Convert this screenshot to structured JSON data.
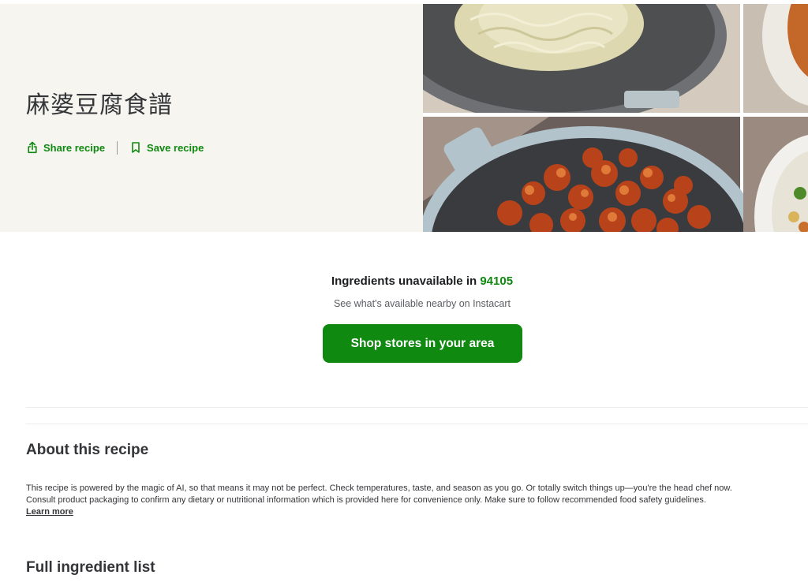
{
  "recipe": {
    "title": "麻婆豆腐食譜",
    "share_label": "Share recipe",
    "save_label": "Save recipe"
  },
  "availability": {
    "title_prefix": "Ingredients unavailable in ",
    "zip": "94105",
    "subtitle": "See what's available nearby on Instacart",
    "button_label": "Shop stores in your area"
  },
  "about": {
    "heading": "About this recipe",
    "line1": "This recipe is powered by the magic of AI, so that means it may not be perfect. Check temperatures, taste, and season as you go. Or totally switch things up—you're the head chef now.",
    "line2": "Consult product packaging to confirm any dietary or nutritional information which is provided here for convenience only. Make sure to follow recommended food safety guidelines.",
    "learn_more": "Learn more"
  },
  "ingredients": {
    "heading": "Full ingredient list"
  },
  "colors": {
    "brand_green": "#108910",
    "hero_bg": "#f6f5f0",
    "text": "#343538"
  },
  "icons": {
    "share": "share-icon",
    "save": "bookmark-icon"
  }
}
